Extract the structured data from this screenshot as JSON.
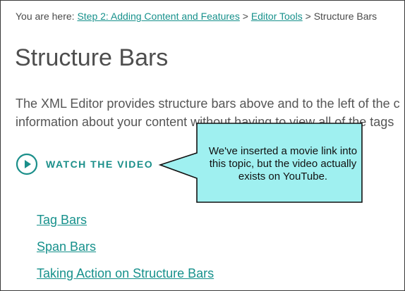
{
  "breadcrumb": {
    "prefix": "You are here: ",
    "items": [
      {
        "label": "Step 2: Adding Content and Features"
      },
      {
        "label": "Editor Tools"
      }
    ],
    "separator": " > ",
    "current": "Structure Bars"
  },
  "page": {
    "title": "Structure Bars",
    "paragraph_line1": "The XML Editor provides structure bars above and to the left of the c",
    "paragraph_line2": "information about your content without having to view all of the tags"
  },
  "video": {
    "label": "WATCH THE VIDEO",
    "icon": "play-circle-icon"
  },
  "links": [
    {
      "label": "Tag Bars"
    },
    {
      "label": "Span Bars"
    },
    {
      "label": "Taking Action on Structure Bars"
    }
  ],
  "callout": {
    "text": "We've inserted a movie link into this topic, but the video actually exists on YouTube.",
    "fill": "#9ff0f0",
    "stroke": "#111111"
  },
  "colors": {
    "link": "#17918c",
    "text": "#555555",
    "title": "#4e4e4e"
  }
}
